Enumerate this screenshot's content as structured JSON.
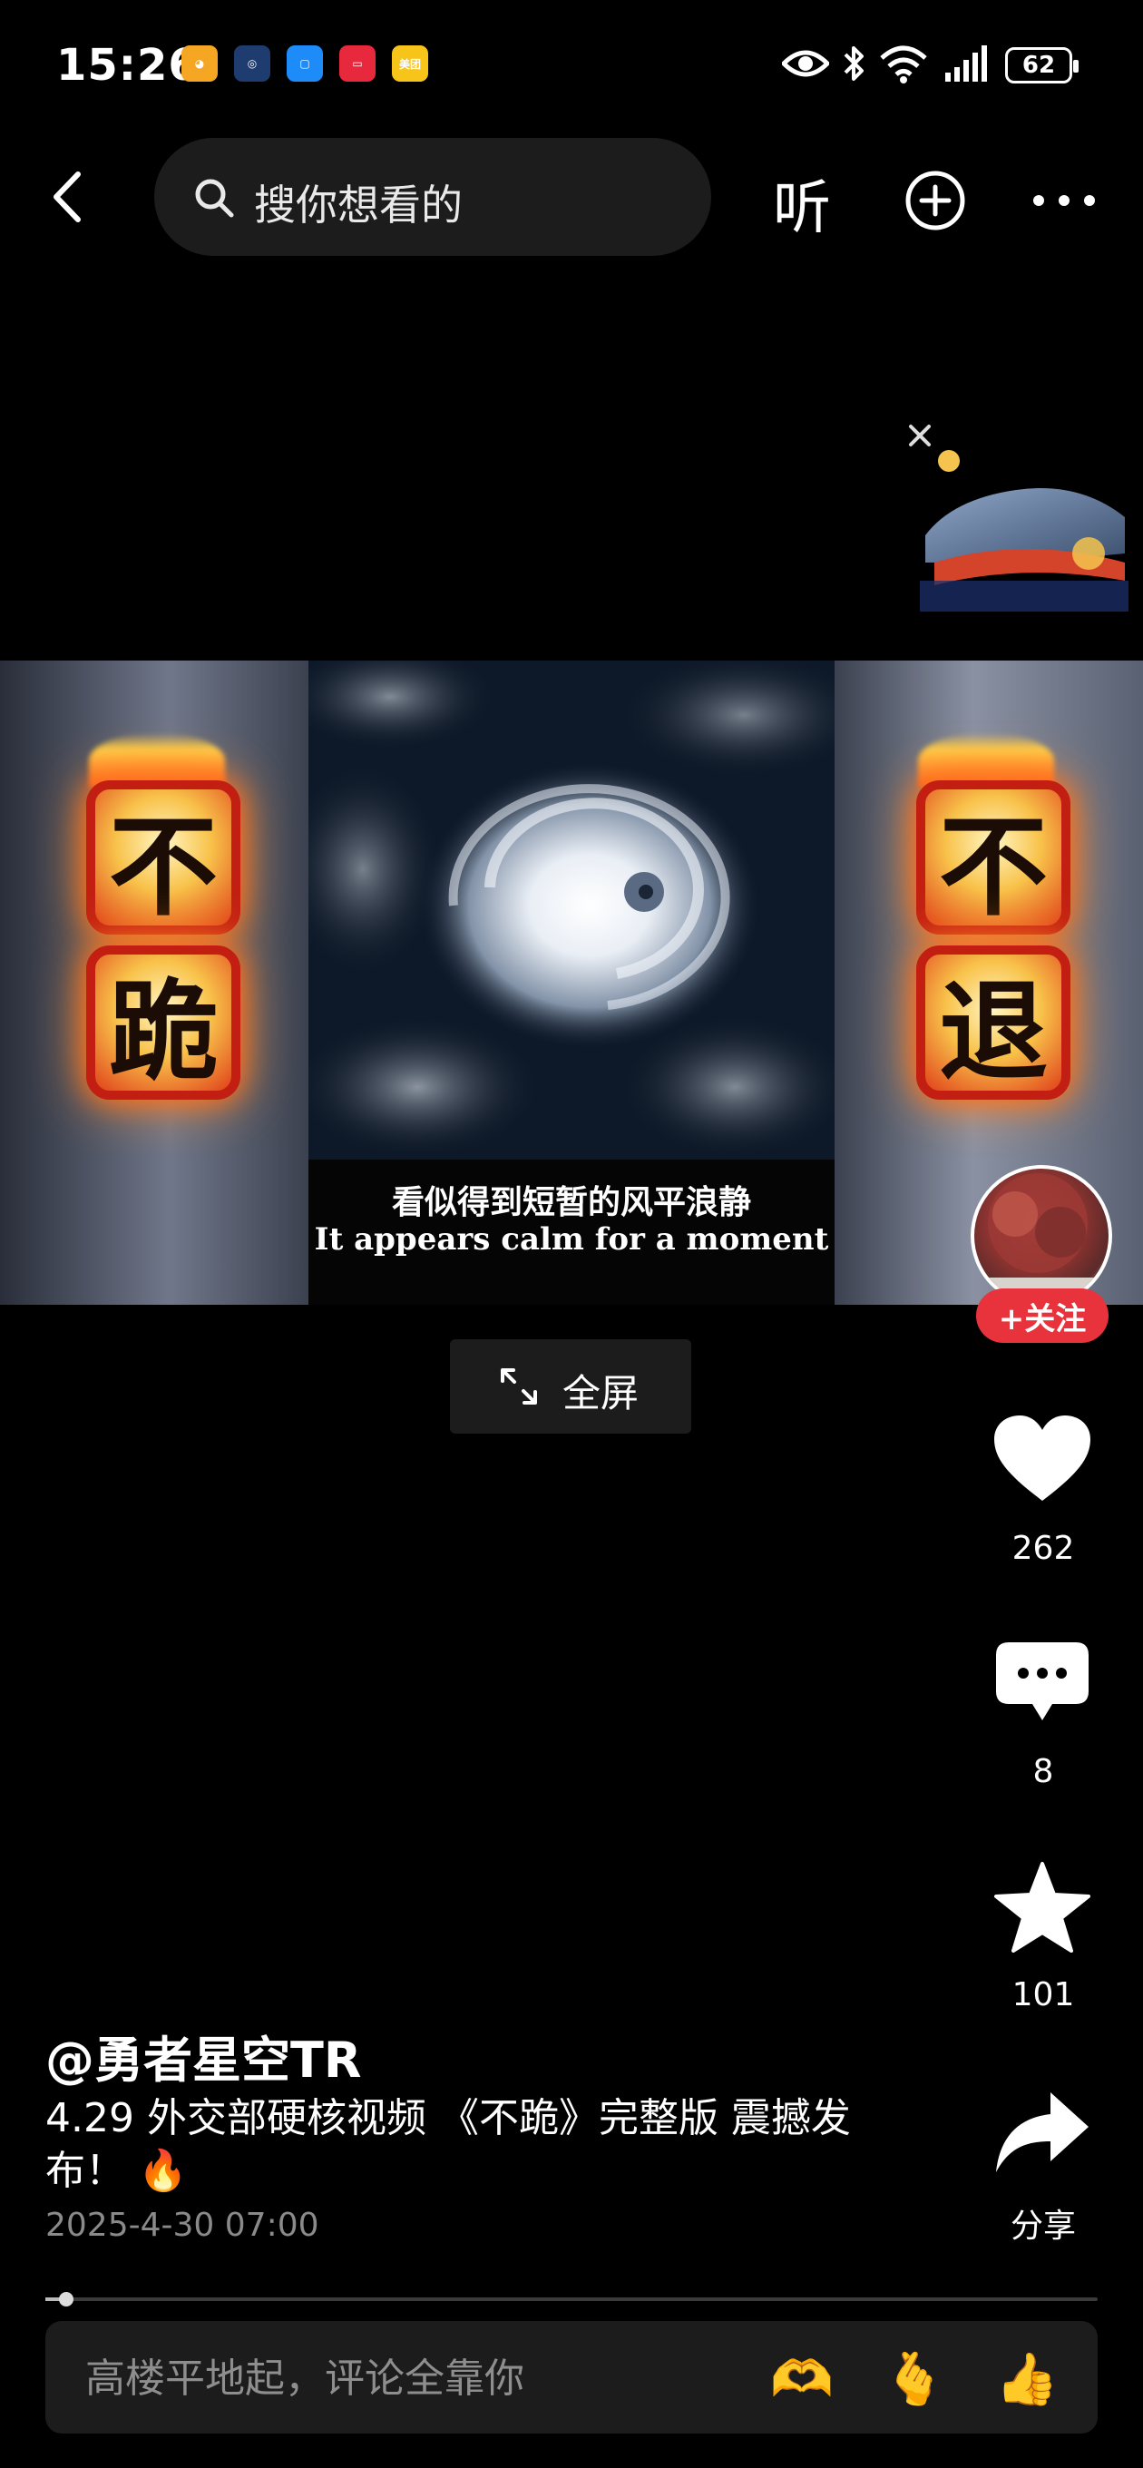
{
  "status_bar": {
    "time": "15:26",
    "battery": "62",
    "app_icons": [
      {
        "name": "weibo-icon",
        "color": "#f5a623",
        "glyph": "◕"
      },
      {
        "name": "browser-icon",
        "color": "#1f3c70",
        "glyph": "◎"
      },
      {
        "name": "chat-icon",
        "color": "#1d8cf8",
        "glyph": "▢"
      },
      {
        "name": "red-app-icon",
        "color": "#e8283c",
        "glyph": "▭"
      },
      {
        "name": "meituan-icon",
        "color": "#f7c41a",
        "glyph": "美团"
      }
    ]
  },
  "top_nav": {
    "search_placeholder": "搜你想看的",
    "listen_label": "听"
  },
  "video": {
    "left_text": [
      "不",
      "跪"
    ],
    "right_text": [
      "不",
      "退"
    ],
    "subtitle_cn": "看似得到短暂的风平浪静",
    "subtitle_en": "It appears calm for a moment"
  },
  "fullscreen_label": "全屏",
  "actions": {
    "follow_label": "+关注",
    "likes": "262",
    "comments": "8",
    "favorites": "101",
    "share_label": "分享"
  },
  "post": {
    "author": "@勇者星空TR",
    "description": "4.29 外交部硬核视频 《不跪》完整版 震撼发布！ 🔥",
    "date": "2025-4-30 07:00",
    "progress": 0.02
  },
  "comment": {
    "placeholder": "高楼平地起，评论全靠你",
    "emojis": [
      "🫶",
      "🫰",
      "👍"
    ]
  }
}
